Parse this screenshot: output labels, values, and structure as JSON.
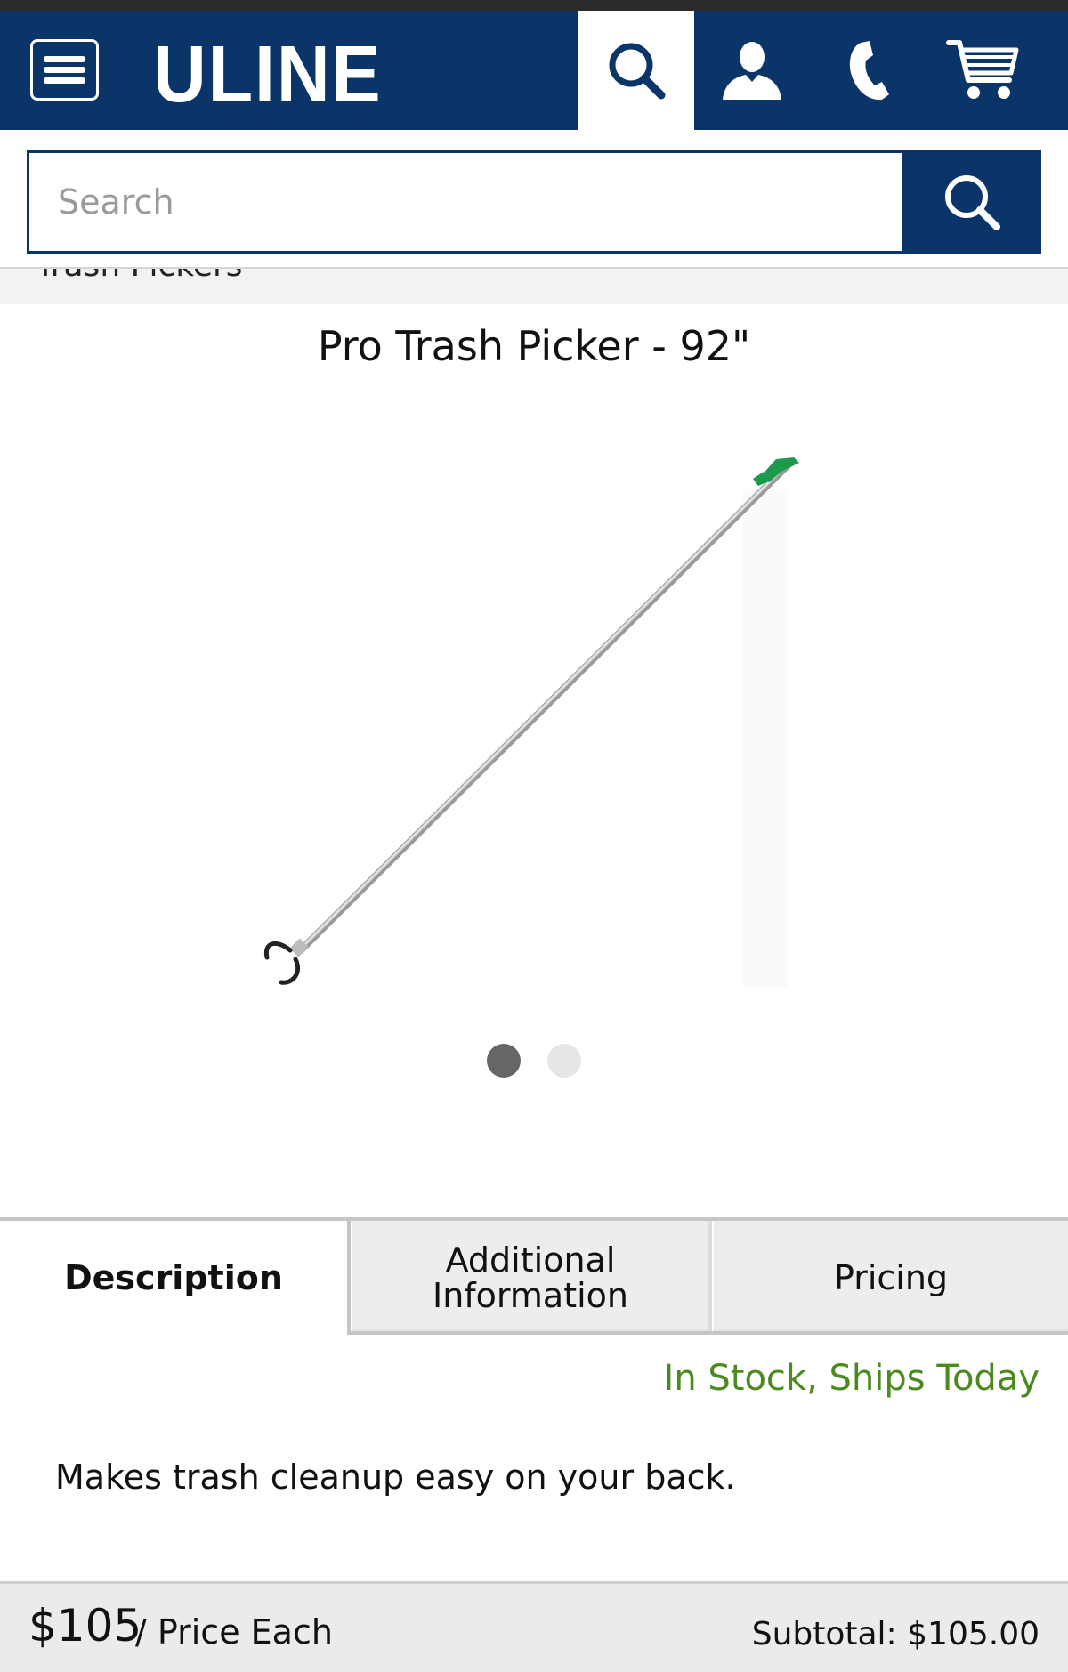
{
  "header": {
    "logo": "ULINE",
    "icons": [
      "menu-icon",
      "search-icon",
      "user-icon",
      "phone-icon",
      "cart-icon"
    ]
  },
  "search": {
    "placeholder": "Search",
    "value": ""
  },
  "breadcrumb": {
    "label": "Trash Pickers"
  },
  "product": {
    "title": "Pro Trash Picker - 92\"",
    "image_count": 2,
    "active_image": 1
  },
  "tabs": [
    {
      "label": "Description",
      "active": true
    },
    {
      "label": "Additional Information",
      "active": false
    },
    {
      "label": "Pricing",
      "active": false
    }
  ],
  "availability": "In Stock, Ships Today",
  "description": "Makes trash cleanup easy on your back.",
  "footer": {
    "price": "$105",
    "price_unit": "/ Price Each",
    "subtotal": "Subtotal: $105.00"
  },
  "colors": {
    "brand_navy": "#0b3468",
    "stock_green": "#4a8a1f",
    "handle_green": "#1a9a4a"
  }
}
